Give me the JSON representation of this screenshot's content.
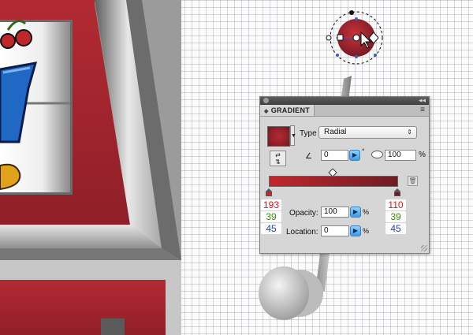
{
  "panel": {
    "title": "GRADIENT",
    "collapse_icon": "double-chevron-right-icon",
    "menu_icon": "panel-menu-icon",
    "type_label": "Type",
    "type_value": "Radial",
    "angle_value": "0",
    "angle_unit": "°",
    "aspect_value": "100",
    "aspect_unit": "%",
    "opacity_label": "Opacity:",
    "opacity_value": "100",
    "opacity_unit": "%",
    "location_label": "Location:",
    "location_value": "0",
    "location_unit": "%"
  },
  "stops": {
    "left": {
      "r": "193",
      "g": "39",
      "b": "45",
      "color": "#c1272d"
    },
    "right": {
      "r": "110",
      "g": "39",
      "b": "45",
      "color": "#6e272d"
    }
  },
  "colors": {
    "slot_red": "#a0242c",
    "gradient_start": "#c1272d",
    "gradient_end": "#6e1b24",
    "selection_blue": "#3a5bd9"
  }
}
